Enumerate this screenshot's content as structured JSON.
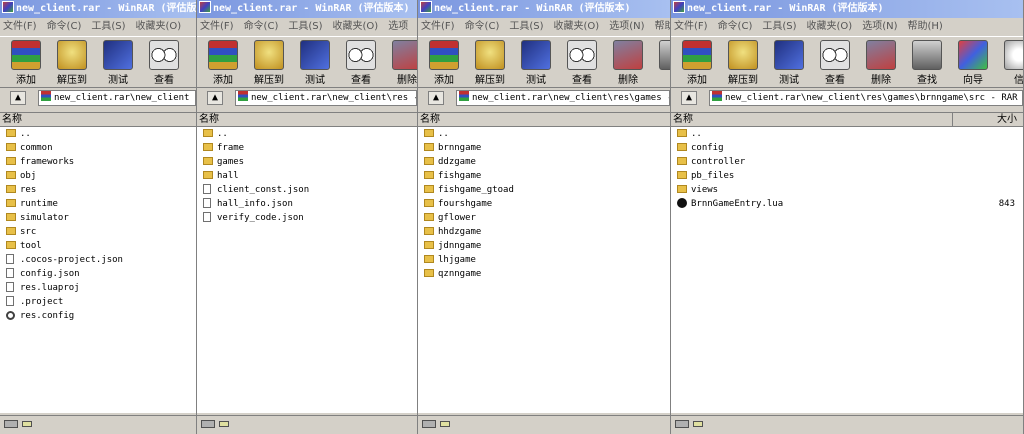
{
  "windows": [
    {
      "title": "new_client.rar - WinRAR (评估版本)",
      "menus": [
        "文件(F)",
        "命令(C)",
        "工具(S)",
        "收藏夹(O)"
      ],
      "tools": [
        {
          "label": "添加",
          "icon": "add-icon"
        },
        {
          "label": "解压到",
          "icon": "extract-icon"
        },
        {
          "label": "测试",
          "icon": "test-icon"
        },
        {
          "label": "查看",
          "icon": "view-icon"
        }
      ],
      "address": "new_client.rar\\new_client",
      "header": {
        "name": "名称",
        "size": ""
      },
      "rows": [
        {
          "name": "..",
          "type": "folder",
          "size": ""
        },
        {
          "name": "common",
          "type": "folder",
          "size": ""
        },
        {
          "name": "frameworks",
          "type": "folder",
          "size": ""
        },
        {
          "name": "obj",
          "type": "folder",
          "size": ""
        },
        {
          "name": "res",
          "type": "folder",
          "size": ""
        },
        {
          "name": "runtime",
          "type": "folder",
          "size": ""
        },
        {
          "name": "simulator",
          "type": "folder",
          "size": ""
        },
        {
          "name": "src",
          "type": "folder",
          "size": ""
        },
        {
          "name": "tool",
          "type": "folder",
          "size": ""
        },
        {
          "name": ".cocos-project.json",
          "type": "file",
          "size": ""
        },
        {
          "name": "config.json",
          "type": "file",
          "size": ""
        },
        {
          "name": "res.luaproj",
          "type": "file",
          "size": ""
        },
        {
          "name": ".project",
          "type": "file",
          "size": ""
        },
        {
          "name": "res.config",
          "type": "config",
          "size": ""
        }
      ]
    },
    {
      "title": "new_client.rar - WinRAR (评估版本)",
      "menus": [
        "文件(F)",
        "命令(C)",
        "工具(S)",
        "收藏夹(O)",
        "选项"
      ],
      "tools": [
        {
          "label": "添加",
          "icon": "add-icon"
        },
        {
          "label": "解压到",
          "icon": "extract-icon"
        },
        {
          "label": "测试",
          "icon": "test-icon"
        },
        {
          "label": "查看",
          "icon": "view-icon"
        },
        {
          "label": "删除",
          "icon": "delete-icon"
        }
      ],
      "address": "new_client.rar\\new_client\\res - ",
      "header": {
        "name": "名称",
        "size": ""
      },
      "rows": [
        {
          "name": "..",
          "type": "folder",
          "size": ""
        },
        {
          "name": "frame",
          "type": "folder",
          "size": ""
        },
        {
          "name": "games",
          "type": "folder",
          "size": ""
        },
        {
          "name": "hall",
          "type": "folder",
          "size": ""
        },
        {
          "name": "client_const.json",
          "type": "file",
          "size": ""
        },
        {
          "name": "hall_info.json",
          "type": "file",
          "size": ""
        },
        {
          "name": "verify_code.json",
          "type": "file",
          "size": ""
        }
      ]
    },
    {
      "title": "new_client.rar - WinRAR (评估版本)",
      "menus": [
        "文件(F)",
        "命令(C)",
        "工具(S)",
        "收藏夹(O)",
        "选项(N)",
        "帮助"
      ],
      "tools": [
        {
          "label": "添加",
          "icon": "add-icon"
        },
        {
          "label": "解压到",
          "icon": "extract-icon"
        },
        {
          "label": "测试",
          "icon": "test-icon"
        },
        {
          "label": "查看",
          "icon": "view-icon"
        },
        {
          "label": "删除",
          "icon": "delete-icon"
        },
        {
          "label": "",
          "icon": "find-icon"
        }
      ],
      "address": "new_client.rar\\new_client\\res\\games - ",
      "header": {
        "name": "名称",
        "size": ""
      },
      "rows": [
        {
          "name": "..",
          "type": "folder",
          "size": ""
        },
        {
          "name": "brnngame",
          "type": "folder",
          "size": ""
        },
        {
          "name": "ddzgame",
          "type": "folder",
          "size": ""
        },
        {
          "name": "fishgame",
          "type": "folder",
          "size": ""
        },
        {
          "name": "fishgame_gtoad",
          "type": "folder",
          "size": ""
        },
        {
          "name": "fourshgame",
          "type": "folder",
          "size": ""
        },
        {
          "name": "gflower",
          "type": "folder",
          "size": ""
        },
        {
          "name": "hhdzgame",
          "type": "folder",
          "size": ""
        },
        {
          "name": "jdnngame",
          "type": "folder",
          "size": ""
        },
        {
          "name": "lhjgame",
          "type": "folder",
          "size": ""
        },
        {
          "name": "qznngame",
          "type": "folder",
          "size": ""
        }
      ]
    },
    {
      "title": "new_client.rar - WinRAR (评估版本)",
      "menus": [
        "文件(F)",
        "命令(C)",
        "工具(S)",
        "收藏夹(O)",
        "选项(N)",
        "帮助(H)"
      ],
      "tools": [
        {
          "label": "添加",
          "icon": "add-icon"
        },
        {
          "label": "解压到",
          "icon": "extract-icon"
        },
        {
          "label": "测试",
          "icon": "test-icon"
        },
        {
          "label": "查看",
          "icon": "view-icon"
        },
        {
          "label": "删除",
          "icon": "delete-icon"
        },
        {
          "label": "查找",
          "icon": "find-icon"
        },
        {
          "label": "向导",
          "icon": "wizard-icon"
        },
        {
          "label": "信",
          "icon": "info-icon"
        }
      ],
      "address": "new_client.rar\\new_client\\res\\games\\brnngame\\src - RAR 压缩",
      "header": {
        "name": "名称",
        "size": "大小"
      },
      "rows": [
        {
          "name": "..",
          "type": "folder",
          "size": ""
        },
        {
          "name": "config",
          "type": "folder",
          "size": ""
        },
        {
          "name": "controller",
          "type": "folder",
          "size": ""
        },
        {
          "name": "pb_files",
          "type": "folder",
          "size": ""
        },
        {
          "name": "views",
          "type": "folder",
          "size": ""
        },
        {
          "name": "BrnnGameEntry.lua",
          "type": "lua",
          "size": "843"
        }
      ]
    }
  ]
}
